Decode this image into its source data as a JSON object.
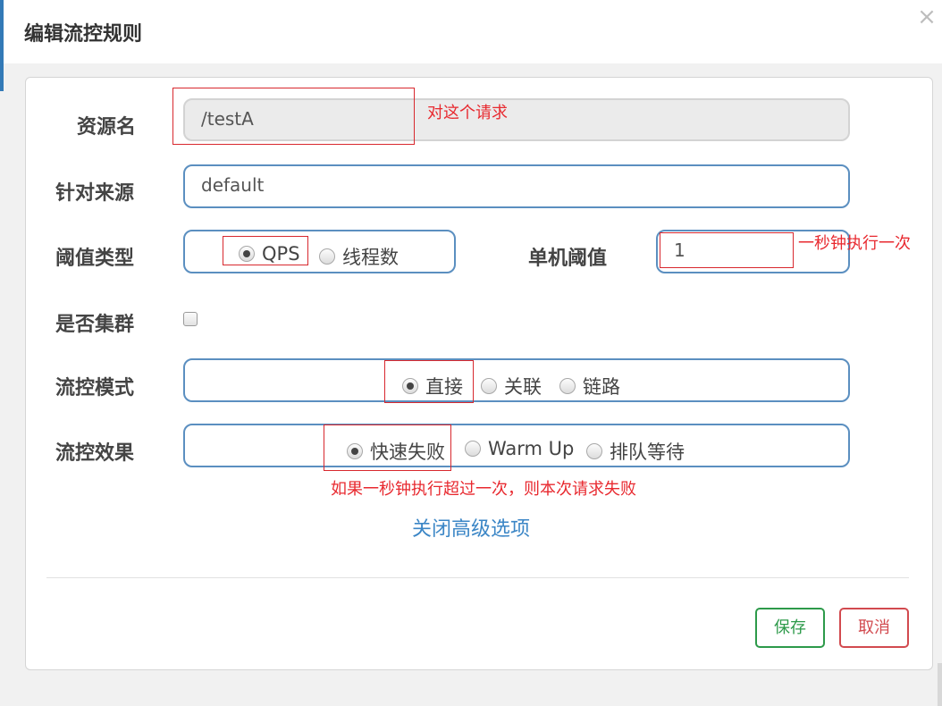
{
  "dialog": {
    "title": "编辑流控规则",
    "close_glyph": "×"
  },
  "form": {
    "resource_name": {
      "label": "资源名",
      "value": "/testA"
    },
    "limit_app": {
      "label": "针对来源",
      "value": "default"
    },
    "threshold_type": {
      "label": "阈值类型",
      "options": [
        "QPS",
        "线程数"
      ],
      "selected": "QPS"
    },
    "single_threshold": {
      "label": "单机阈值",
      "value": "1"
    },
    "cluster_mode": {
      "label": "是否集群",
      "checked": false
    },
    "flow_mode": {
      "label": "流控模式",
      "options": [
        "直接",
        "关联",
        "链路"
      ],
      "selected": "直接"
    },
    "control_behavior": {
      "label": "流控效果",
      "options": [
        "快速失败",
        "Warm Up",
        "排队等待"
      ],
      "selected": "快速失败"
    },
    "advanced_toggle": "关闭高级选项"
  },
  "annotations": {
    "resource_note": "对这个请求",
    "threshold_note": "一秒钟执行一次",
    "behavior_note": "如果一秒钟执行超过一次，则本次请求失败"
  },
  "footer": {
    "save_label": "保存",
    "cancel_label": "取消"
  },
  "colors": {
    "accent": "#337ab7",
    "input_border": "#5b8fc0",
    "link": "#3b86c6",
    "annotation": "#e8292f",
    "save": "#2d9a4a",
    "cancel": "#d24a4f"
  }
}
